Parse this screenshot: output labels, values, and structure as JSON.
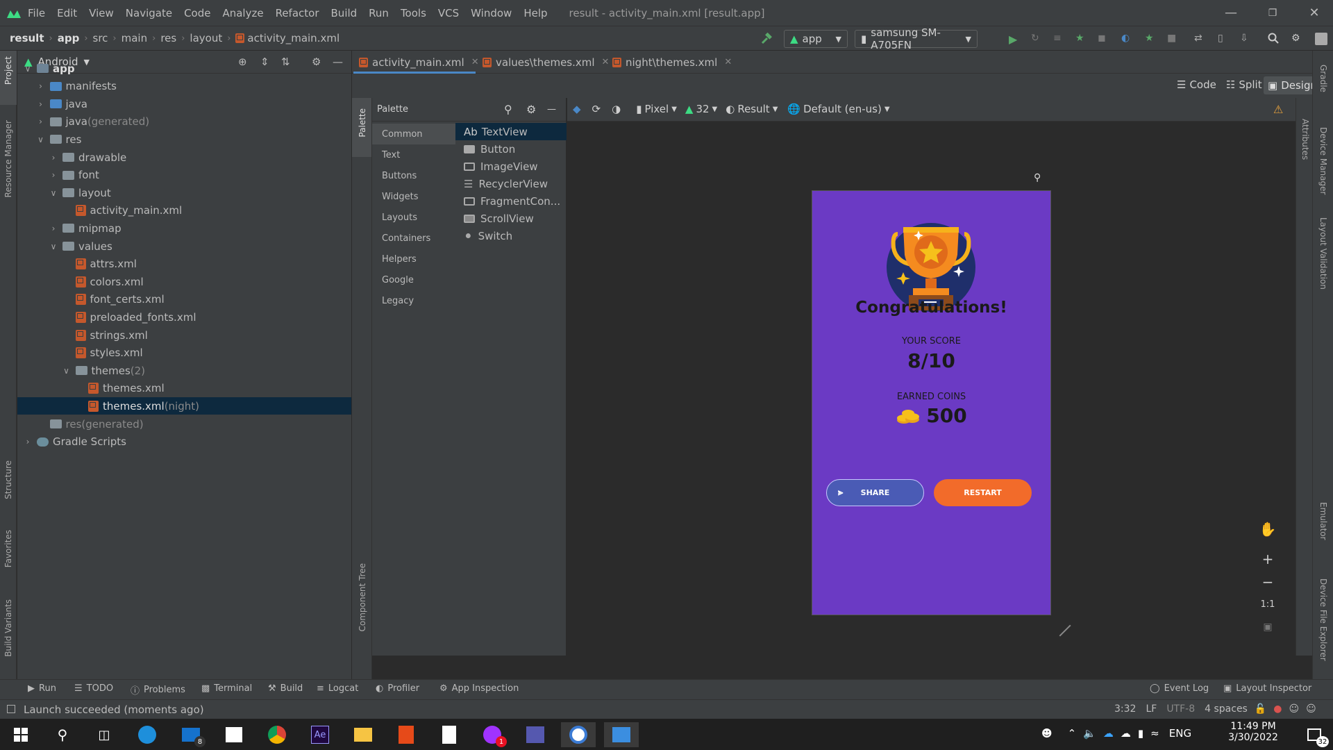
{
  "window": {
    "title": "result - activity_main.xml [result.app]",
    "menu": [
      "File",
      "Edit",
      "View",
      "Navigate",
      "Code",
      "Analyze",
      "Refactor",
      "Build",
      "Run",
      "Tools",
      "VCS",
      "Window",
      "Help"
    ]
  },
  "breadcrumb": [
    "result",
    "app",
    "src",
    "main",
    "res",
    "layout",
    "activity_main.xml"
  ],
  "toolbar": {
    "run_config": "app",
    "device": "samsung SM-A705FN"
  },
  "left_stripe": [
    "Project",
    "Resource Manager",
    "Structure",
    "Favorites",
    "Build Variants"
  ],
  "right_stripe": [
    "Gradle",
    "Device Manager",
    "Layout Validation",
    "Emulator",
    "Device File Explorer"
  ],
  "project": {
    "view": "Android",
    "tree": [
      {
        "label": "app",
        "suffix": "",
        "kind": "module",
        "chev": "v"
      },
      {
        "label": "manifests",
        "suffix": "",
        "kind": "folder-blue",
        "chev": ">"
      },
      {
        "label": "java",
        "suffix": "",
        "kind": "folder-blue",
        "chev": ">"
      },
      {
        "label": "java",
        "suffix": " (generated)",
        "kind": "folder-gen",
        "chev": ">"
      },
      {
        "label": "res",
        "suffix": "",
        "kind": "folder",
        "chev": "v"
      },
      {
        "label": "drawable",
        "suffix": "",
        "kind": "folder",
        "chev": ">"
      },
      {
        "label": "font",
        "suffix": "",
        "kind": "folder",
        "chev": ">"
      },
      {
        "label": "layout",
        "suffix": "",
        "kind": "folder",
        "chev": "v"
      },
      {
        "label": "activity_main.xml",
        "suffix": "",
        "kind": "xml",
        "chev": ""
      },
      {
        "label": "mipmap",
        "suffix": "",
        "kind": "folder",
        "chev": ">"
      },
      {
        "label": "values",
        "suffix": "",
        "kind": "folder",
        "chev": "v"
      },
      {
        "label": "attrs.xml",
        "suffix": "",
        "kind": "xml",
        "chev": ""
      },
      {
        "label": "colors.xml",
        "suffix": "",
        "kind": "xml",
        "chev": ""
      },
      {
        "label": "font_certs.xml",
        "suffix": "",
        "kind": "xml",
        "chev": ""
      },
      {
        "label": "preloaded_fonts.xml",
        "suffix": "",
        "kind": "xml",
        "chev": ""
      },
      {
        "label": "strings.xml",
        "suffix": "",
        "kind": "xml",
        "chev": ""
      },
      {
        "label": "styles.xml",
        "suffix": "",
        "kind": "xml",
        "chev": ""
      },
      {
        "label": "themes",
        "suffix": " (2)",
        "kind": "folder",
        "chev": "v"
      },
      {
        "label": "themes.xml",
        "suffix": "",
        "kind": "xml",
        "chev": ""
      },
      {
        "label": "themes.xml",
        "suffix": " (night)",
        "kind": "xml",
        "chev": ""
      },
      {
        "label": "res",
        "suffix": " (generated)",
        "kind": "folder-gen",
        "chev": ""
      },
      {
        "label": "Gradle Scripts",
        "suffix": "",
        "kind": "gradle",
        "chev": ">"
      }
    ]
  },
  "editor_tabs": [
    "activity_main.xml",
    "values\\themes.xml",
    "night\\themes.xml"
  ],
  "view_modes": {
    "code": "Code",
    "split": "Split",
    "design": "Design"
  },
  "palette": {
    "title": "Palette",
    "categories": [
      "Common",
      "Text",
      "Buttons",
      "Widgets",
      "Layouts",
      "Containers",
      "Helpers",
      "Google",
      "Legacy"
    ],
    "items": [
      {
        "label": "TextView",
        "prefix": "Ab"
      },
      {
        "label": "Button",
        "prefix": ""
      },
      {
        "label": "ImageView",
        "prefix": ""
      },
      {
        "label": "RecyclerView",
        "prefix": ""
      },
      {
        "label": "FragmentCon...",
        "prefix": ""
      },
      {
        "label": "ScrollView",
        "prefix": ""
      },
      {
        "label": "Switch",
        "prefix": ""
      }
    ]
  },
  "design_toolbar": {
    "device": "Pixel",
    "api": "32",
    "theme": "Result",
    "locale": "Default (en-us)",
    "margin": "0dp"
  },
  "component_tree_label": "Component Tree",
  "attributes_label": "Attributes",
  "palette_stripe_label": "Palette",
  "phone": {
    "background": "#6b3ac4",
    "title": "Congratulations!",
    "score_label": "YOUR SCORE",
    "score": "8/10",
    "coins_label": "EARNED COINS",
    "coins": "500",
    "share_label": "SHARE",
    "restart_label": "RESTART",
    "share_color": "#4a5bb5",
    "restart_color": "#f26b2a"
  },
  "zoom": {
    "fit": "1:1"
  },
  "bottom_tools": [
    "Run",
    "TODO",
    "Problems",
    "Terminal",
    "Build",
    "Logcat",
    "Profiler",
    "App Inspection"
  ],
  "bottom_right_tools": [
    "Event Log",
    "Layout Inspector"
  ],
  "status": {
    "message": "Launch succeeded (moments ago)",
    "position": "3:32",
    "line_sep": "LF",
    "encoding": "UTF-8",
    "indent": "4 spaces"
  },
  "taskbar": {
    "lang": "ENG",
    "time": "11:49 PM",
    "date": "3/30/2022",
    "mail_badge": "8",
    "chrome_badge": "1",
    "notif_count": "32"
  }
}
